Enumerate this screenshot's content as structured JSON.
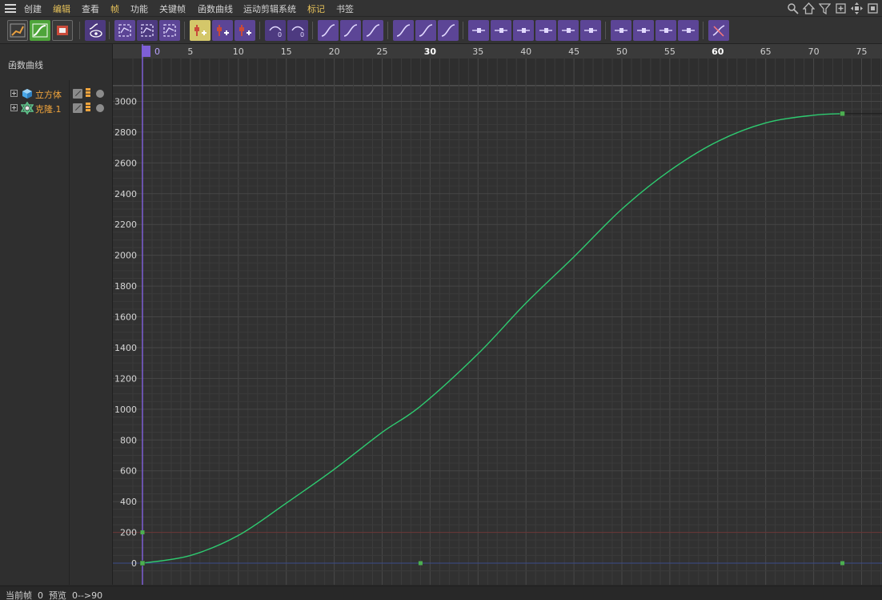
{
  "menu": {
    "items": [
      {
        "label": "创建",
        "highlight": false
      },
      {
        "label": "编辑",
        "highlight": true
      },
      {
        "label": "查看",
        "highlight": false
      },
      {
        "label": "帧",
        "highlight": true
      },
      {
        "label": "功能",
        "highlight": false
      },
      {
        "label": "关键帧",
        "highlight": false
      },
      {
        "label": "函数曲线",
        "highlight": false
      },
      {
        "label": "运动剪辑系统",
        "highlight": false
      },
      {
        "label": "标记",
        "highlight": true
      },
      {
        "label": "书签",
        "highlight": false
      }
    ],
    "right_icons": [
      "search-icon",
      "home-icon",
      "filter-icon",
      "new-window-icon",
      "move-icon",
      "expand-icon"
    ]
  },
  "toolbar": {
    "groups": [
      [
        "dopesheet-icon",
        "fcurve-icon",
        "motion-mode-icon"
      ],
      [
        "fcurve-eye-icon"
      ],
      [
        "frame-all-icon",
        "frame-selected-icon",
        "frame-range-icon"
      ],
      [
        "add-key-icon",
        "add-multi-key-icon",
        "remove-key-icon"
      ],
      [
        "zero-angle-icon",
        "zero-length-icon"
      ],
      [
        "spline-ease-icon",
        "spline-linear-icon",
        "spline-step-icon"
      ],
      [
        "ease-in-out-icon",
        "ease-in-icon",
        "ease-out-icon"
      ],
      [
        "tangent-zero-a-icon",
        "tangent-zero-b-icon",
        "tangent-auto-icon",
        "tangent-break-icon",
        "tangent-lock-icon",
        "tangent-unify-icon"
      ],
      [
        "lock-time-icon",
        "lock-value-icon",
        "lock-tangent-icon",
        "lock-length-icon"
      ],
      [
        "muted-curve-icon"
      ]
    ]
  },
  "left_panel": {
    "title": "函数曲线",
    "objects": [
      {
        "label": "立方体",
        "icon": "cube-object-icon"
      },
      {
        "label": "克隆.1",
        "icon": "cloner-object-icon"
      }
    ]
  },
  "timeline": {
    "current_frame_label": "0",
    "ticks": [
      "5",
      "10",
      "15",
      "20",
      "25",
      "30",
      "35",
      "40",
      "45",
      "50",
      "55",
      "60",
      "65",
      "70",
      "75"
    ],
    "bold_ticks": [
      "30",
      "60"
    ]
  },
  "chart_data": {
    "type": "line",
    "title": "",
    "xlabel": "",
    "ylabel": "",
    "xlim": [
      -0.9,
      79.3
    ],
    "ylim": [
      -40,
      3040
    ],
    "yticks": [
      0,
      200,
      400,
      600,
      800,
      1000,
      1200,
      1400,
      1600,
      1800,
      2000,
      2200,
      2400,
      2600,
      2800,
      3000
    ],
    "xticks": [
      5,
      10,
      15,
      20,
      25,
      30,
      35,
      40,
      45,
      50,
      55,
      60,
      65,
      70,
      75
    ],
    "current_frame": 0,
    "series": [
      {
        "color": "#2ecc71",
        "x": [
          0,
          5,
          10,
          15,
          20,
          25,
          29,
          35,
          40,
          45,
          50,
          55,
          60,
          65,
          70,
          73
        ],
        "y": [
          0,
          50,
          180,
          390,
          610,
          850,
          1020,
          1360,
          1690,
          1990,
          2300,
          2550,
          2740,
          2860,
          2910,
          2920
        ],
        "keyframes": [
          [
            0,
            0
          ],
          [
            73,
            2920
          ]
        ]
      }
    ],
    "markers": [
      [
        0,
        200
      ],
      [
        29,
        0
      ],
      [
        73,
        0
      ]
    ],
    "reference_lines": [
      {
        "y": 0,
        "color": "#3b4a8c"
      },
      {
        "y": 200,
        "color": "#6a3535"
      }
    ]
  },
  "status": {
    "current_frame_label": "当前帧",
    "current_frame_value": "0",
    "preview_label": "预览",
    "preview_value": "0-->90"
  }
}
